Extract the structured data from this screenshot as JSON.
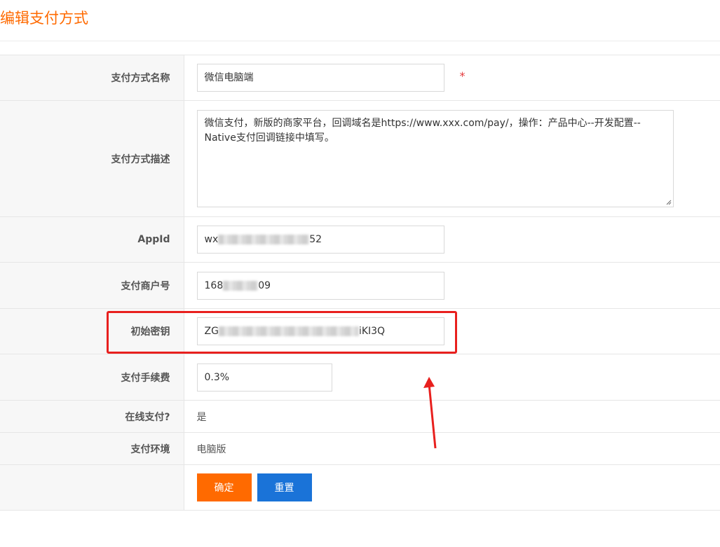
{
  "page": {
    "title": "编辑支付方式"
  },
  "form": {
    "name": {
      "label": "支付方式名称",
      "value": "微信电脑端",
      "required_mark": "*"
    },
    "description": {
      "label": "支付方式描述",
      "value": "微信支付，新版的商家平台，回调域名是https://www.xxx.com/pay/，操作：产品中心--开发配置--Native支付回调链接中填写。"
    },
    "appid": {
      "label": "AppId",
      "prefix": "wx",
      "suffix": "52"
    },
    "merchant": {
      "label": "支付商户号",
      "prefix": "168",
      "suffix": "09"
    },
    "secret": {
      "label": "初始密钥",
      "prefix": "ZG",
      "suffix": "iKI3Q"
    },
    "fee": {
      "label": "支付手续费",
      "value": "0.3%"
    },
    "online": {
      "label": "在线支付?",
      "value": "是"
    },
    "env": {
      "label": "支付环境",
      "value": "电脑版"
    },
    "buttons": {
      "ok": "确定",
      "reset": "重置"
    }
  },
  "annotation": {
    "color": "#e8201e"
  },
  "colors": {
    "accent": "#ff6a00",
    "primary": "#1a73d8",
    "required": "#e4393c"
  }
}
